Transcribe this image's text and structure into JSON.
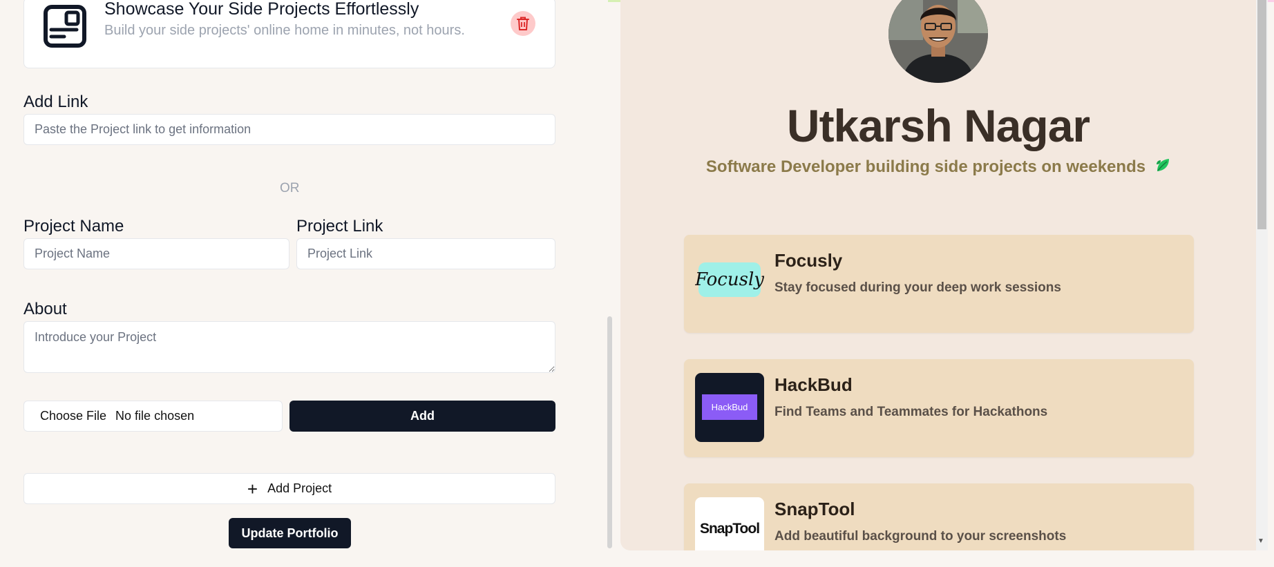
{
  "editor": {
    "project_card": {
      "title": "Showcase Your Side Projects Effortlessly",
      "subtitle": "Build your side projects' online home in minutes, not hours.",
      "icon": "card-layout-icon",
      "delete_icon": "trash-icon"
    },
    "add_link": {
      "label": "Add Link",
      "placeholder": "Paste the Project link to get information"
    },
    "divider_text": "OR",
    "project_name": {
      "label": "Project Name",
      "placeholder": "Project Name"
    },
    "project_link": {
      "label": "Project Link",
      "placeholder": "Project Link"
    },
    "about": {
      "label": "About",
      "placeholder": "Introduce your Project"
    },
    "file_input": {
      "button_label": "Choose File",
      "status": "No file chosen"
    },
    "add_button": "Add",
    "add_project_button": "Add Project",
    "update_button": "Update Portfolio"
  },
  "preview": {
    "name": "Utkarsh Nagar",
    "tagline": "Software Developer building side projects on weekends",
    "projects": [
      {
        "title": "Focusly",
        "description": "Stay focused during your deep work sessions",
        "logo_text": "Focusly"
      },
      {
        "title": "HackBud",
        "description": "Find Teams and Teammates for Hackathons",
        "logo_text": "HackBud"
      },
      {
        "title": "SnapTool",
        "description": "Add beautiful background to your screenshots",
        "logo_text": "SnapTool"
      }
    ]
  },
  "colors": {
    "dark_button": "#111827",
    "preview_bg": "#f3e8df",
    "project_card_bg": "#efdcc0",
    "tagline": "#8b7a4a",
    "danger_soft": "#fecaca"
  }
}
